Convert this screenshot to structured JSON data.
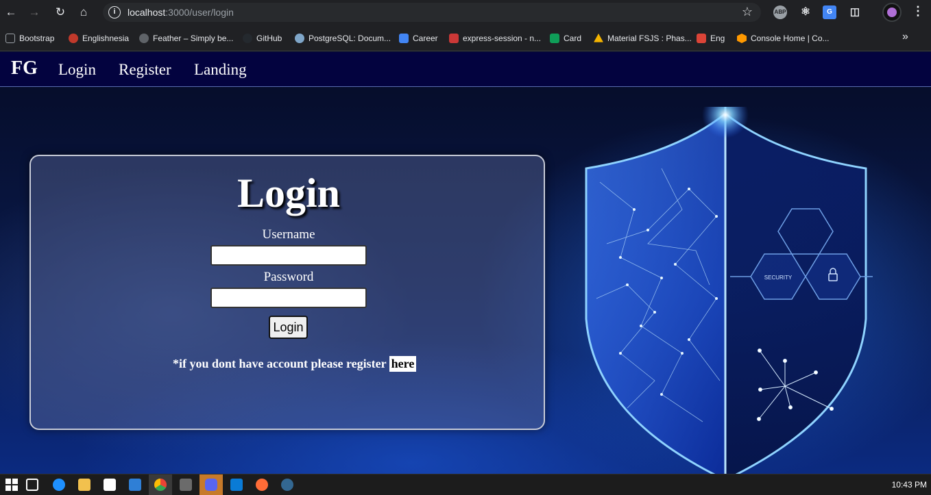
{
  "browser": {
    "url_host": "localhost",
    "url_path": ":3000/user/login",
    "extensions": [
      "ABP",
      "react-devtools",
      "translate",
      "extensions"
    ],
    "bookmarks": [
      {
        "label": "Bootstrap",
        "color": "#9aa0a6"
      },
      {
        "label": "Englishnesia",
        "color": "#c0392b"
      },
      {
        "label": "Feather – Simply be...",
        "color": "#5f6368"
      },
      {
        "label": "GitHub",
        "color": "#24292e"
      },
      {
        "label": "PostgreSQL: Docum...",
        "color": "#7fa6c9"
      },
      {
        "label": "Career",
        "color": "#4285f4"
      },
      {
        "label": "express-session - n...",
        "color": "#cb3837"
      },
      {
        "label": "Card",
        "color": "#0f9d58"
      },
      {
        "label": "Material FSJS : Phas...",
        "color": "#f4b400"
      },
      {
        "label": "Eng",
        "color": "#db4437"
      },
      {
        "label": "Console Home | Co...",
        "color": "#ff9900"
      }
    ]
  },
  "navbar": {
    "brand": "FG",
    "links": [
      "Login",
      "Register",
      "Landing"
    ]
  },
  "login_card": {
    "title": "Login",
    "username_label": "Username",
    "password_label": "Password",
    "username_value": "",
    "password_value": "",
    "submit_label": "Login",
    "register_text": "*if you dont have account please register",
    "register_link": "here"
  },
  "shield": {
    "security_label": "SECURITY"
  },
  "taskbar": {
    "time": "10:43 PM"
  }
}
